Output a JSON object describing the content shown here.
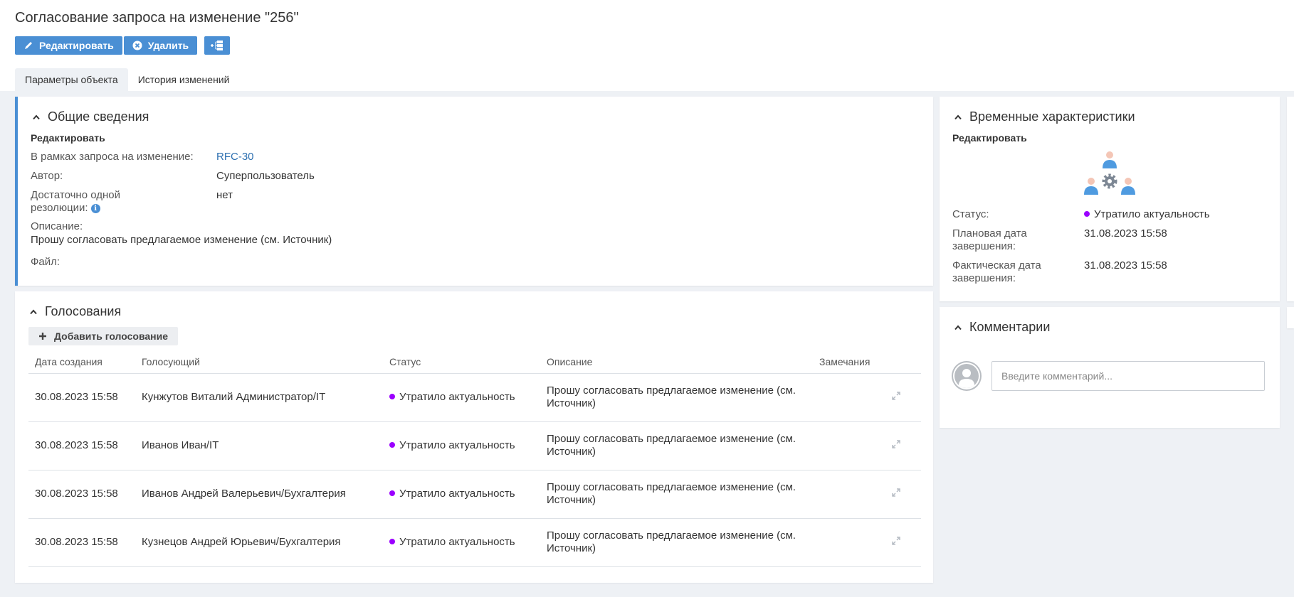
{
  "header": {
    "title": "Согласование запроса на изменение \"256\"",
    "edit_label": "Редактировать",
    "delete_label": "Удалить",
    "colors": {
      "primary": "#4a8fd4",
      "status_obsolete": "#9b00ff"
    }
  },
  "tabs": [
    {
      "label": "Параметры объекта"
    },
    {
      "label": "История изменений"
    }
  ],
  "general": {
    "title": "Общие сведения",
    "edit_label": "Редактировать",
    "rfc_label": "В рамках запроса на изменение:",
    "rfc_value": "RFC-30",
    "author_label": "Автор:",
    "author_value": "Суперпользователь",
    "single_resolution_label_line1": "Достаточно одной",
    "single_resolution_label_line2": "резолюции:",
    "single_resolution_value": "нет",
    "description_label": "Описание:",
    "description_value": "Прошу согласовать предлагаемое изменение (см. Источник)",
    "file_label": "Файл:"
  },
  "votes": {
    "title": "Голосования",
    "add_label": "Добавить голосование",
    "columns": [
      "Дата создания",
      "Голосующий",
      "Статус",
      "Описание",
      "Замечания"
    ],
    "rows": [
      {
        "date": "30.08.2023 15:58",
        "voter": "Кунжутов Виталий Администратор/IT",
        "status": "Утратило актуальность",
        "description": "Прошу согласовать предлагаемое изменение (см. Источник)"
      },
      {
        "date": "30.08.2023 15:58",
        "voter": "Иванов Иван/IT",
        "status": "Утратило актуальность",
        "description": "Прошу согласовать предлагаемое изменение (см. Источник)"
      },
      {
        "date": "30.08.2023 15:58",
        "voter": "Иванов Андрей Валерьевич/Бухгалтерия",
        "status": "Утратило актуальность",
        "description": "Прошу согласовать предлагаемое изменение (см. Источник)"
      },
      {
        "date": "30.08.2023 15:58",
        "voter": "Кузнецов Андрей Юрьевич/Бухгалтерия",
        "status": "Утратило актуальность",
        "description": "Прошу согласовать предлагаемое изменение (см. Источник)"
      }
    ]
  },
  "timing": {
    "title": "Временные характеристики",
    "edit_label": "Редактировать",
    "status_label": "Статус:",
    "status_value": "Утратило актуальность",
    "planned_label_line1": "Плановая дата",
    "planned_label_line2": "завершения:",
    "planned_value": "31.08.2023 15:58",
    "actual_label_line1": "Фактическая дата",
    "actual_label_line2": "завершения:",
    "actual_value": "31.08.2023 15:58"
  },
  "comments": {
    "title": "Комментарии",
    "placeholder": "Введите комментарий..."
  }
}
